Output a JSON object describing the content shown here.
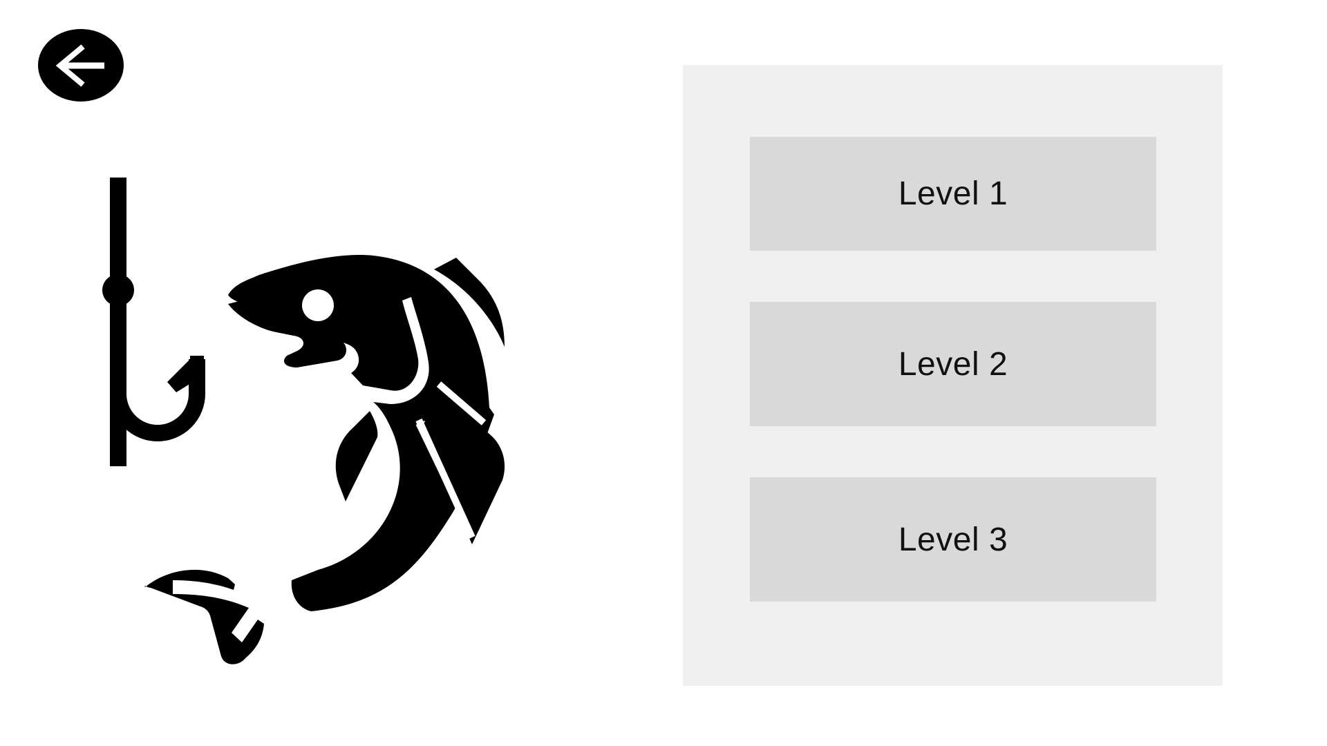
{
  "screen": {
    "background": "#ffffff"
  },
  "back_button": {
    "icon": "arrow-left-icon"
  },
  "illustration": {
    "icons": [
      "fish-hook-icon",
      "fish-icon"
    ]
  },
  "level_panel": {
    "background": "#f0f0f0",
    "button_color": "#d9d9d9",
    "levels": [
      {
        "label": "Level 1"
      },
      {
        "label": "Level 2"
      },
      {
        "label": "Level 3"
      }
    ]
  }
}
